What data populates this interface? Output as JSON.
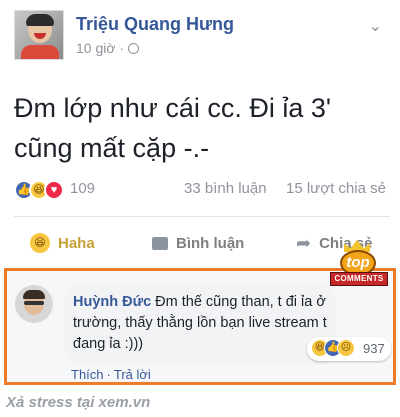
{
  "post": {
    "author": "Triệu Quang Hưng",
    "time": "10 giờ ·",
    "menu_glyph": "⌄",
    "text": "Đm lớp như cái cc. Đi ỉa 3'\ncũng mất cặp -.-"
  },
  "stats": {
    "reaction_count": "109",
    "comments": "33 bình luận",
    "shares": "15 lượt chia sẻ"
  },
  "actions": {
    "haha": "Haha",
    "comment": "Bình luận",
    "share": "Chia sẻ"
  },
  "comment": {
    "author": "Huỳnh Đức",
    "text": "Đm thế cũng than, t đi ỉa ở trường, thấy thằng lồn bạn live stream t đang ỉa :)))",
    "reaction_count": "937",
    "like_label": "Thích",
    "separator": "·",
    "reply_label": "Trả lời"
  },
  "badge": {
    "top": "top",
    "banner": "COMMENTS"
  },
  "watermark": "Xả stress tại xem.vn",
  "colors": {
    "highlight_border": "#ee7a2a",
    "link_blue": "#365899",
    "meta_gray": "#90949c"
  }
}
